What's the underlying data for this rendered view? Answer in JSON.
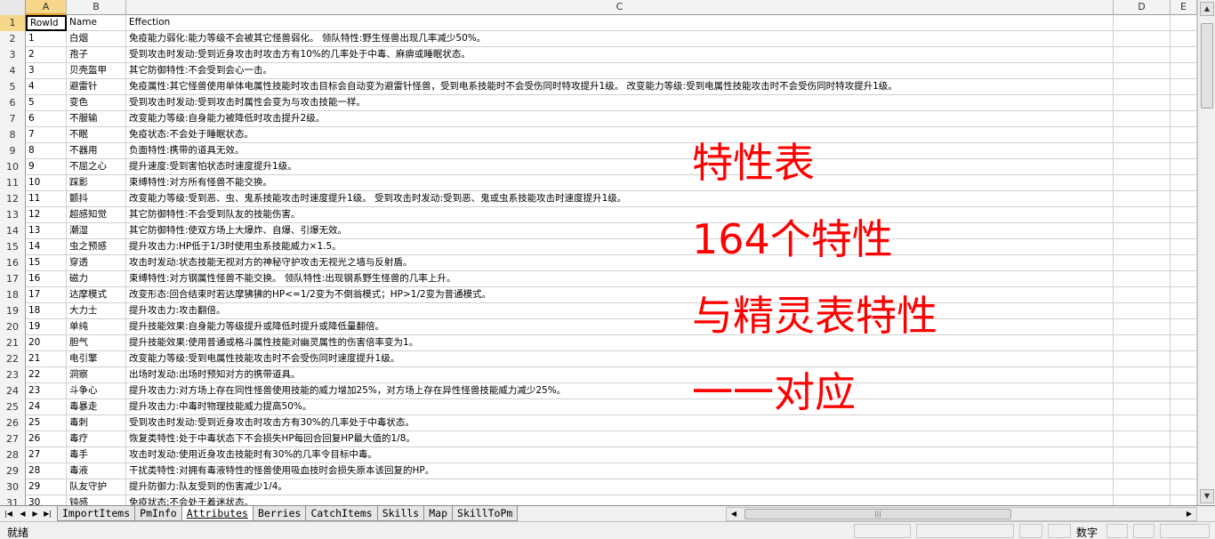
{
  "columns": [
    "A",
    "B",
    "C",
    "D",
    "E"
  ],
  "active_column": "A",
  "header_row": {
    "row_num": "1",
    "a": "RowId",
    "b": "Name",
    "c": "Effection"
  },
  "rows": [
    {
      "n": "2",
      "a": "1",
      "b": "白烟",
      "c": "免疫能力弱化:能力等级不会被其它怪兽弱化。 领队特性:野生怪兽出现几率减少50%。"
    },
    {
      "n": "3",
      "a": "2",
      "b": "孢子",
      "c": "受到攻击时发动:受到近身攻击时攻击方有10%的几率处于中毒、麻痹或睡眠状态。"
    },
    {
      "n": "4",
      "a": "3",
      "b": "贝壳盔甲",
      "c": "其它防御特性:不会受到会心一击。"
    },
    {
      "n": "5",
      "a": "4",
      "b": "避雷针",
      "c": "免疫属性:其它怪兽使用单体电属性技能时攻击目标会自动变为避雷针怪兽，受到电系技能时不会受伤同时特攻提升1级。 改变能力等级:受到电属性技能攻击时不会受伤同时特攻提升1级。"
    },
    {
      "n": "6",
      "a": "5",
      "b": "变色",
      "c": "受到攻击时发动:受到攻击时属性会变为与攻击技能一样。"
    },
    {
      "n": "7",
      "a": "6",
      "b": "不服输",
      "c": "改变能力等级:自身能力被降低时攻击提升2级。"
    },
    {
      "n": "8",
      "a": "7",
      "b": "不眠",
      "c": "免疫状态:不会处于睡眠状态。"
    },
    {
      "n": "9",
      "a": "8",
      "b": "不器用",
      "c": "负面特性:携带的道具无效。"
    },
    {
      "n": "10",
      "a": "9",
      "b": "不屈之心",
      "c": "提升速度:受到害怕状态时速度提升1级。"
    },
    {
      "n": "11",
      "a": "10",
      "b": "踩影",
      "c": "束缚特性:对方所有怪兽不能交换。"
    },
    {
      "n": "12",
      "a": "11",
      "b": "颤抖",
      "c": "改变能力等级:受到恶、虫、鬼系技能攻击时速度提升1级。 受到攻击时发动:受到恶、鬼或虫系技能攻击时速度提升1级。"
    },
    {
      "n": "13",
      "a": "12",
      "b": "超感知觉",
      "c": "其它防御特性:不会受到队友的技能伤害。"
    },
    {
      "n": "14",
      "a": "13",
      "b": "潮湿",
      "c": "其它防御特性:使双方场上大爆炸、自爆、引爆无效。"
    },
    {
      "n": "15",
      "a": "14",
      "b": "虫之预感",
      "c": "提升攻击力:HP低于1/3时使用虫系技能威力×1.5。"
    },
    {
      "n": "16",
      "a": "15",
      "b": "穿透",
      "c": "攻击时发动:状态技能无视对方的神秘守护攻击无视光之墙与反射盾。"
    },
    {
      "n": "17",
      "a": "16",
      "b": "磁力",
      "c": "束缚特性:对方钢属性怪兽不能交换。 领队特性:出现钢系野生怪兽的几率上升。"
    },
    {
      "n": "18",
      "a": "17",
      "b": "达摩模式",
      "c": "改变形态:回合结束时若达摩狒狒的HP<=1/2变为不倒翁模式；HP>1/2变为普通模式。"
    },
    {
      "n": "19",
      "a": "18",
      "b": "大力士",
      "c": "提升攻击力:攻击翻倍。"
    },
    {
      "n": "20",
      "a": "19",
      "b": "单纯",
      "c": "提升技能效果:自身能力等级提升或降低时提升或降低量翻倍。"
    },
    {
      "n": "21",
      "a": "20",
      "b": "胆气",
      "c": "提升技能效果:使用普通或格斗属性技能对幽灵属性的伤害倍率变为1。"
    },
    {
      "n": "22",
      "a": "21",
      "b": "电引擎",
      "c": "改变能力等级:受到电属性技能攻击时不会受伤同时速度提升1级。"
    },
    {
      "n": "23",
      "a": "22",
      "b": "洞察",
      "c": "出场时发动:出场时预知对方的携带道具。"
    },
    {
      "n": "24",
      "a": "23",
      "b": "斗争心",
      "c": "提升攻击力:对方场上存在同性怪兽使用技能的威力增加25%，对方场上存在异性怪兽技能威力减少25%。"
    },
    {
      "n": "25",
      "a": "24",
      "b": "毒暴走",
      "c": "提升攻击力:中毒时物理技能威力提高50%。"
    },
    {
      "n": "26",
      "a": "25",
      "b": "毒刺",
      "c": "受到攻击时发动:受到近身攻击时攻击方有30%的几率处于中毒状态。"
    },
    {
      "n": "27",
      "a": "26",
      "b": "毒疗",
      "c": "恢复类特性:处于中毒状态下不会损失HP每回合回复HP最大值的1/8。"
    },
    {
      "n": "28",
      "a": "27",
      "b": "毒手",
      "c": "攻击时发动:使用近身攻击技能时有30%的几率令目标中毒。"
    },
    {
      "n": "29",
      "a": "28",
      "b": "毒液",
      "c": "干扰类特性:对拥有毒液特性的怪兽使用吸血技时会损失原本该回复的HP。"
    },
    {
      "n": "30",
      "a": "29",
      "b": "队友守护",
      "c": "提升防御力:队友受到的伤害减少1/4。"
    },
    {
      "n": "31",
      "a": "30",
      "b": "钝感",
      "c": "免疫状态:不会处于着迷状态。"
    }
  ],
  "overlay": [
    "特性表",
    "164个特性",
    "与精灵表特性",
    "一一对应"
  ],
  "sheet_tabs": [
    "ImportItems",
    "PmInfo",
    "Attributes",
    "Berries",
    "CatchItems",
    "Skills",
    "Map",
    "SkillToPm"
  ],
  "active_tab": "Attributes",
  "status": {
    "ready": "就绪",
    "num_mode": "数字"
  },
  "colors": {
    "overlay_text": "#ff0000",
    "active_header": "#f7d88b"
  }
}
